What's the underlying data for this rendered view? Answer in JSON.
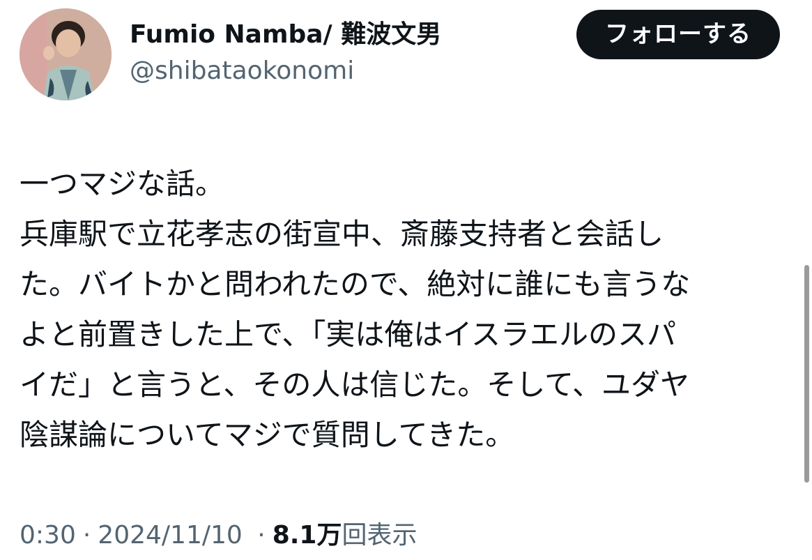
{
  "user": {
    "display_name": "Fumio Namba/ 難波文男",
    "handle": "@shibataokonomi",
    "avatar_icon": "child-portrait-avatar"
  },
  "follow_button": {
    "label": "フォローする"
  },
  "tweet": {
    "lines": [
      "一つマジな話。",
      "兵庫駅で立花孝志の街宣中、斎藤支持者と会話し",
      "た。バイトかと問われたので、絶対に誰にも言うな",
      "よと前置きした上で、「実は俺はイスラエルのスパ",
      "イだ」と言うと、その人は信じた。そして、ユダヤ",
      "陰謀論についてマジで質問してきた。"
    ]
  },
  "meta": {
    "time": "0:30",
    "separator": "·",
    "date": "2024/11/10",
    "views_count": "8.1万",
    "views_label": "回表示"
  },
  "colors": {
    "text": "#0f1419",
    "secondary": "#536471",
    "button_bg": "#0f1419",
    "button_text": "#ffffff"
  }
}
